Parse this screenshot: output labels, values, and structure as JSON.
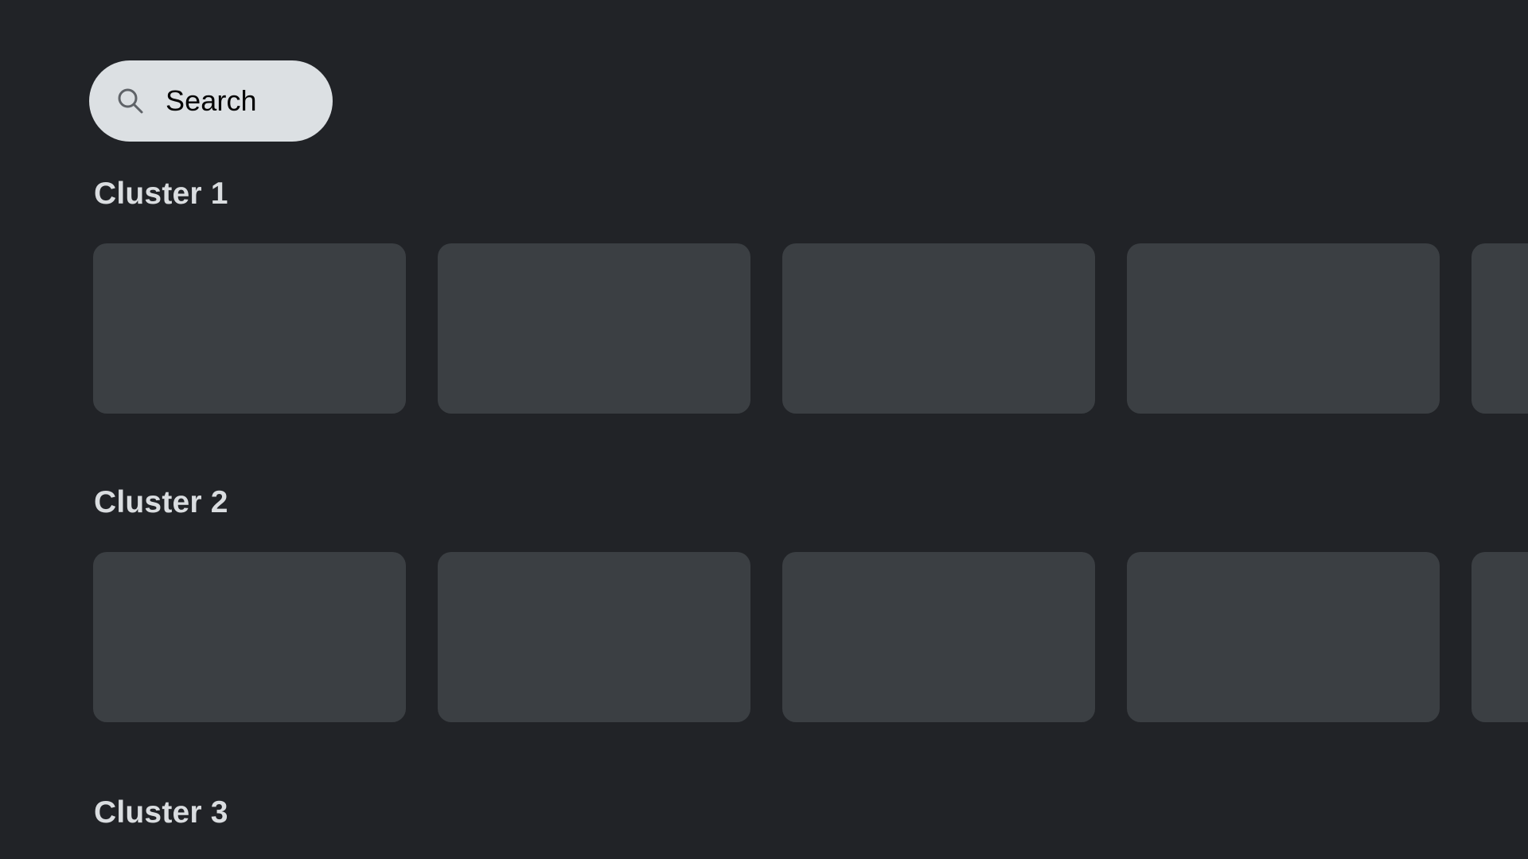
{
  "theme": {
    "background": "#212327",
    "card_fill": "#3b3f43",
    "heading_color": "#dadde0",
    "search_pill_fill": "#dce0e3",
    "search_text_color": "#050505",
    "search_icon_color": "#5f6368"
  },
  "search": {
    "label": "Search",
    "icon": "search-icon"
  },
  "clusters": [
    {
      "title": "Cluster 1",
      "cards": [
        {
          "id": "cluster-1-card-1"
        },
        {
          "id": "cluster-1-card-2"
        },
        {
          "id": "cluster-1-card-3"
        },
        {
          "id": "cluster-1-card-4"
        },
        {
          "id": "cluster-1-card-5"
        }
      ]
    },
    {
      "title": "Cluster 2",
      "cards": [
        {
          "id": "cluster-2-card-1"
        },
        {
          "id": "cluster-2-card-2"
        },
        {
          "id": "cluster-2-card-3"
        },
        {
          "id": "cluster-2-card-4"
        },
        {
          "id": "cluster-2-card-5"
        }
      ]
    },
    {
      "title": "Cluster 3",
      "cards": []
    }
  ]
}
